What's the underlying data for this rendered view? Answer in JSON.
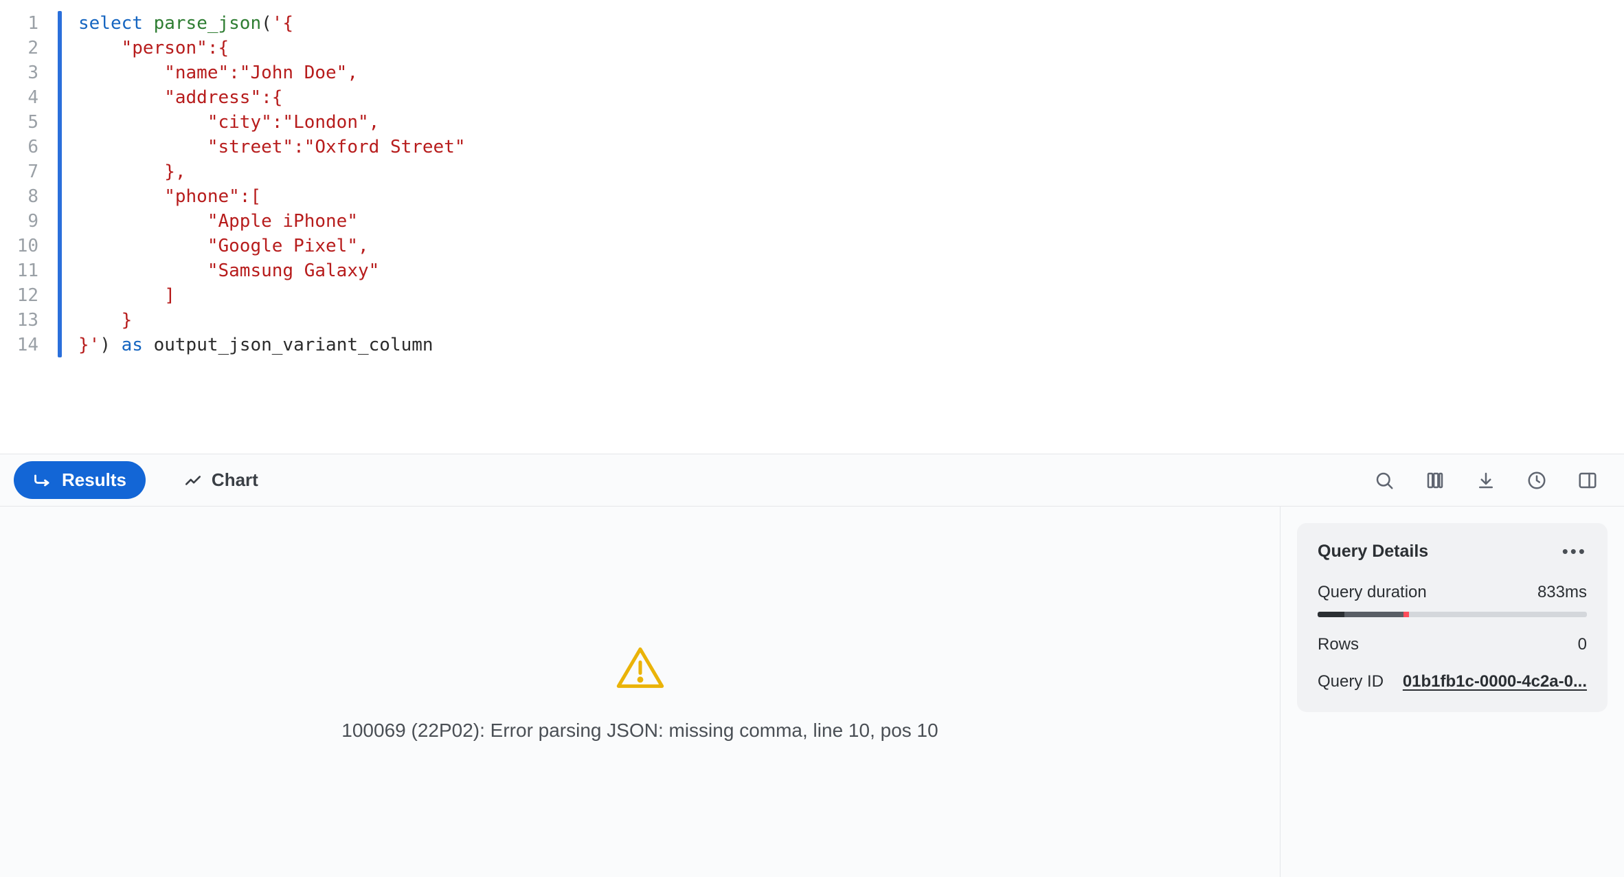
{
  "editor": {
    "line_count": 14,
    "tokens": [
      [
        {
          "t": "select",
          "c": "kw"
        },
        {
          "t": " ",
          "c": "plain"
        },
        {
          "t": "parse_json",
          "c": "fn"
        },
        {
          "t": "(",
          "c": "plain"
        },
        {
          "t": "'{",
          "c": "str"
        }
      ],
      [
        {
          "t": "    \"person\":{",
          "c": "str"
        }
      ],
      [
        {
          "t": "        \"name\":\"John Doe\",",
          "c": "str"
        }
      ],
      [
        {
          "t": "        \"address\":{",
          "c": "str"
        }
      ],
      [
        {
          "t": "            \"city\":\"London\",",
          "c": "str"
        }
      ],
      [
        {
          "t": "            \"street\":\"Oxford Street\"",
          "c": "str"
        }
      ],
      [
        {
          "t": "        },",
          "c": "str"
        }
      ],
      [
        {
          "t": "        \"phone\":[",
          "c": "str"
        }
      ],
      [
        {
          "t": "            \"Apple iPhone\"",
          "c": "str"
        }
      ],
      [
        {
          "t": "            \"Google Pixel\",",
          "c": "str"
        }
      ],
      [
        {
          "t": "            \"Samsung Galaxy\"",
          "c": "str"
        }
      ],
      [
        {
          "t": "        ]",
          "c": "str"
        }
      ],
      [
        {
          "t": "    }",
          "c": "str"
        }
      ],
      [
        {
          "t": "}'",
          "c": "str"
        },
        {
          "t": ") ",
          "c": "plain"
        },
        {
          "t": "as",
          "c": "kw"
        },
        {
          "t": " output_json_variant_column",
          "c": "plain"
        }
      ]
    ]
  },
  "tabs": {
    "results_label": "Results",
    "chart_label": "Chart"
  },
  "toolbar_icons": {
    "search": "search-icon",
    "columns": "columns-icon",
    "download": "download-icon",
    "history": "clock-icon",
    "panel": "panel-right-icon"
  },
  "error": {
    "message": "100069 (22P02): Error parsing JSON: missing comma, line 10, pos 10"
  },
  "details": {
    "title": "Query Details",
    "duration_label": "Query duration",
    "duration_value": "833ms",
    "rows_label": "Rows",
    "rows_value": "0",
    "query_id_label": "Query ID",
    "query_id_value": "01b1fb1c-0000-4c2a-0...",
    "progress": {
      "seg1_pct": 10,
      "seg2_pct": 22,
      "seg3_pct": 2,
      "seg4_pct": 66
    }
  }
}
